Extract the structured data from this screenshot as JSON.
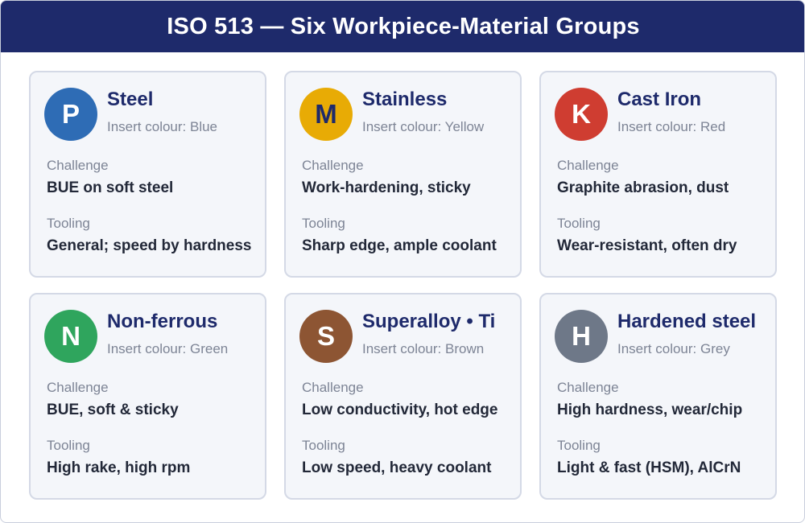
{
  "header": {
    "title": "ISO 513 — Six Workpiece-Material Groups"
  },
  "labels": {
    "challenge": "Challenge",
    "tooling": "Tooling"
  },
  "groups": [
    {
      "letter": "P",
      "name": "Steel",
      "insert": "Insert colour: Blue",
      "color": "#2e6cb5",
      "challenge": "BUE on soft steel",
      "tooling": "General; speed by hardness"
    },
    {
      "letter": "M",
      "name": "Stainless",
      "insert": "Insert colour: Yellow",
      "color": "#e8ab05",
      "challenge": "Work-hardening, sticky",
      "tooling": "Sharp edge, ample coolant"
    },
    {
      "letter": "K",
      "name": "Cast Iron",
      "insert": "Insert colour: Red",
      "color": "#cf3d31",
      "challenge": "Graphite abrasion, dust",
      "tooling": "Wear-resistant, often dry"
    },
    {
      "letter": "N",
      "name": "Non-ferrous",
      "insert": "Insert colour: Green",
      "color": "#2fa55d",
      "challenge": "BUE, soft & sticky",
      "tooling": "High rake, high rpm"
    },
    {
      "letter": "S",
      "name": "Superalloy • Ti",
      "insert": "Insert colour: Brown",
      "color": "#8d5533",
      "challenge": "Low conductivity, hot edge",
      "tooling": "Low speed, heavy coolant"
    },
    {
      "letter": "H",
      "name": "Hardened steel",
      "insert": "Insert colour: Grey",
      "color": "#6e7888",
      "challenge": "High hardness, wear/chip",
      "tooling": "Light & fast (HSM), AlCrN"
    }
  ]
}
